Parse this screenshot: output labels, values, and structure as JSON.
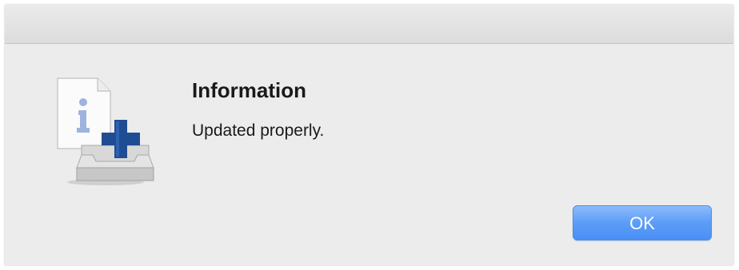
{
  "dialog": {
    "icon": "info-add-to-tray-icon",
    "title": "Information",
    "message": "Updated properly.",
    "ok_label": "OK"
  },
  "colors": {
    "button_accent": "#4a8ff5",
    "plus_accent": "#1f4d94",
    "info_letter": "#9fb3df"
  }
}
